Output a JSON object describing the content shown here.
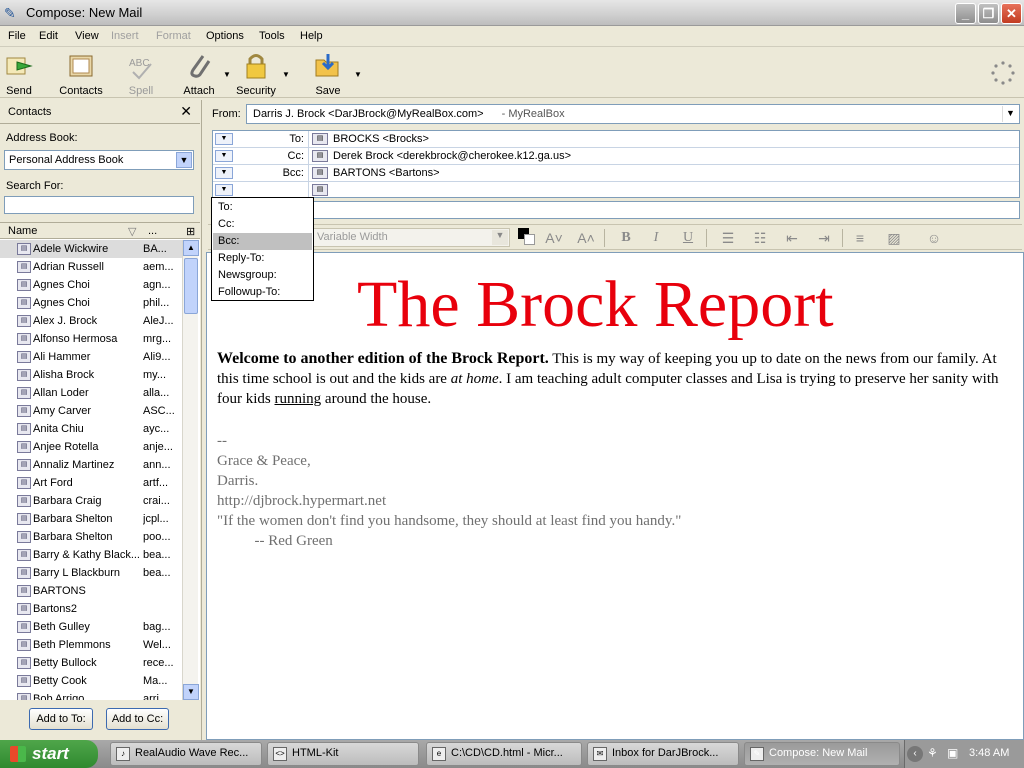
{
  "window": {
    "title": "Compose: New Mail"
  },
  "menubar": [
    "File",
    "Edit",
    "View",
    "Insert",
    "Format",
    "Options",
    "Tools",
    "Help"
  ],
  "menubar_disabled": [
    "Insert",
    "Format"
  ],
  "toolbar": {
    "send": "Send",
    "contacts": "Contacts",
    "spell": "Spell",
    "attach": "Attach",
    "security": "Security",
    "save": "Save"
  },
  "contacts": {
    "title": "Contacts",
    "address_book_label": "Address Book:",
    "address_book_value": "Personal Address Book",
    "search_label": "Search For:",
    "search_value": "",
    "col_name": "Name",
    "col_email": "...",
    "items": [
      {
        "name": "Adele Wickwire",
        "email": "BA..."
      },
      {
        "name": "Adrian Russell",
        "email": "aem..."
      },
      {
        "name": "Agnes Choi",
        "email": "agn..."
      },
      {
        "name": "Agnes Choi",
        "email": "phil..."
      },
      {
        "name": "Alex J. Brock",
        "email": "AleJ..."
      },
      {
        "name": "Alfonso Hermosa",
        "email": "mrg..."
      },
      {
        "name": "Ali Hammer",
        "email": "Ali9..."
      },
      {
        "name": "Alisha Brock",
        "email": "my..."
      },
      {
        "name": "Allan Loder",
        "email": "alla..."
      },
      {
        "name": "Amy Carver",
        "email": "ASC..."
      },
      {
        "name": "Anita Chiu",
        "email": "ayc..."
      },
      {
        "name": "Anjee Rotella",
        "email": "anje..."
      },
      {
        "name": "Annaliz Martinez",
        "email": "ann..."
      },
      {
        "name": "Art Ford",
        "email": "artf..."
      },
      {
        "name": "Barbara Craig",
        "email": "crai..."
      },
      {
        "name": "Barbara Shelton",
        "email": "jcpl..."
      },
      {
        "name": "Barbara Shelton",
        "email": "poo..."
      },
      {
        "name": "Barry & Kathy Black...",
        "email": "bea..."
      },
      {
        "name": "Barry L Blackburn",
        "email": "bea..."
      },
      {
        "name": "BARTONS",
        "email": ""
      },
      {
        "name": "Bartons2",
        "email": ""
      },
      {
        "name": "Beth Gulley",
        "email": "bag..."
      },
      {
        "name": "Beth Plemmons",
        "email": "Wel..."
      },
      {
        "name": "Betty Bullock",
        "email": "rece..."
      },
      {
        "name": "Betty Cook",
        "email": "Ma..."
      },
      {
        "name": "Bob Arrigo",
        "email": "arri..."
      }
    ],
    "add_to": "Add to To:",
    "add_cc": "Add to Cc:"
  },
  "header": {
    "from_label": "From:",
    "from_value": "Darris J. Brock <DarJBrock@MyRealBox.com>",
    "from_account": "- MyRealBox",
    "recipients": [
      {
        "type": "To:",
        "value": "BROCKS <Brocks>"
      },
      {
        "type": "Cc:",
        "value": "Derek Brock <derekbrock@cherokee.k12.ga.us>"
      },
      {
        "type": "Bcc:",
        "value": "BARTONS <Bartons>"
      },
      {
        "type": "",
        "value": ""
      }
    ],
    "subject": ""
  },
  "popup": {
    "items": [
      "To:",
      "Cc:",
      "Bcc:",
      "Reply-To:",
      "Newsgroup:",
      "Followup-To:"
    ],
    "selected": "Bcc:"
  },
  "format": {
    "font": "Variable Width"
  },
  "body": {
    "headline": "The Brock Report",
    "intro_bold": "Welcome to another edition of the Brock Report.",
    "p1": "  This is my way of keeping you up to date on the news from our family.  At this time school is out and the kids are ",
    "p_italic": "at home",
    "p2": ".  I am teaching adult computer classes and Lisa is trying to preserve her sanity with four kids ",
    "p_underline": "running",
    "p3": " around the house.",
    "signature": [
      "--",
      "Grace & Peace,",
      "Darris.",
      "http://djbrock.hypermart.net",
      "\"If the women don't find you handsome, they should at least find you handy.\"",
      "          -- Red Green"
    ]
  },
  "taskbar": {
    "start": "start",
    "tasks": [
      "RealAudio Wave Rec...",
      "HTML-Kit",
      "C:\\CD\\CD.html - Micr...",
      "Inbox for DarJBrock...",
      "Compose: New Mail"
    ],
    "clock": "3:48 AM"
  }
}
